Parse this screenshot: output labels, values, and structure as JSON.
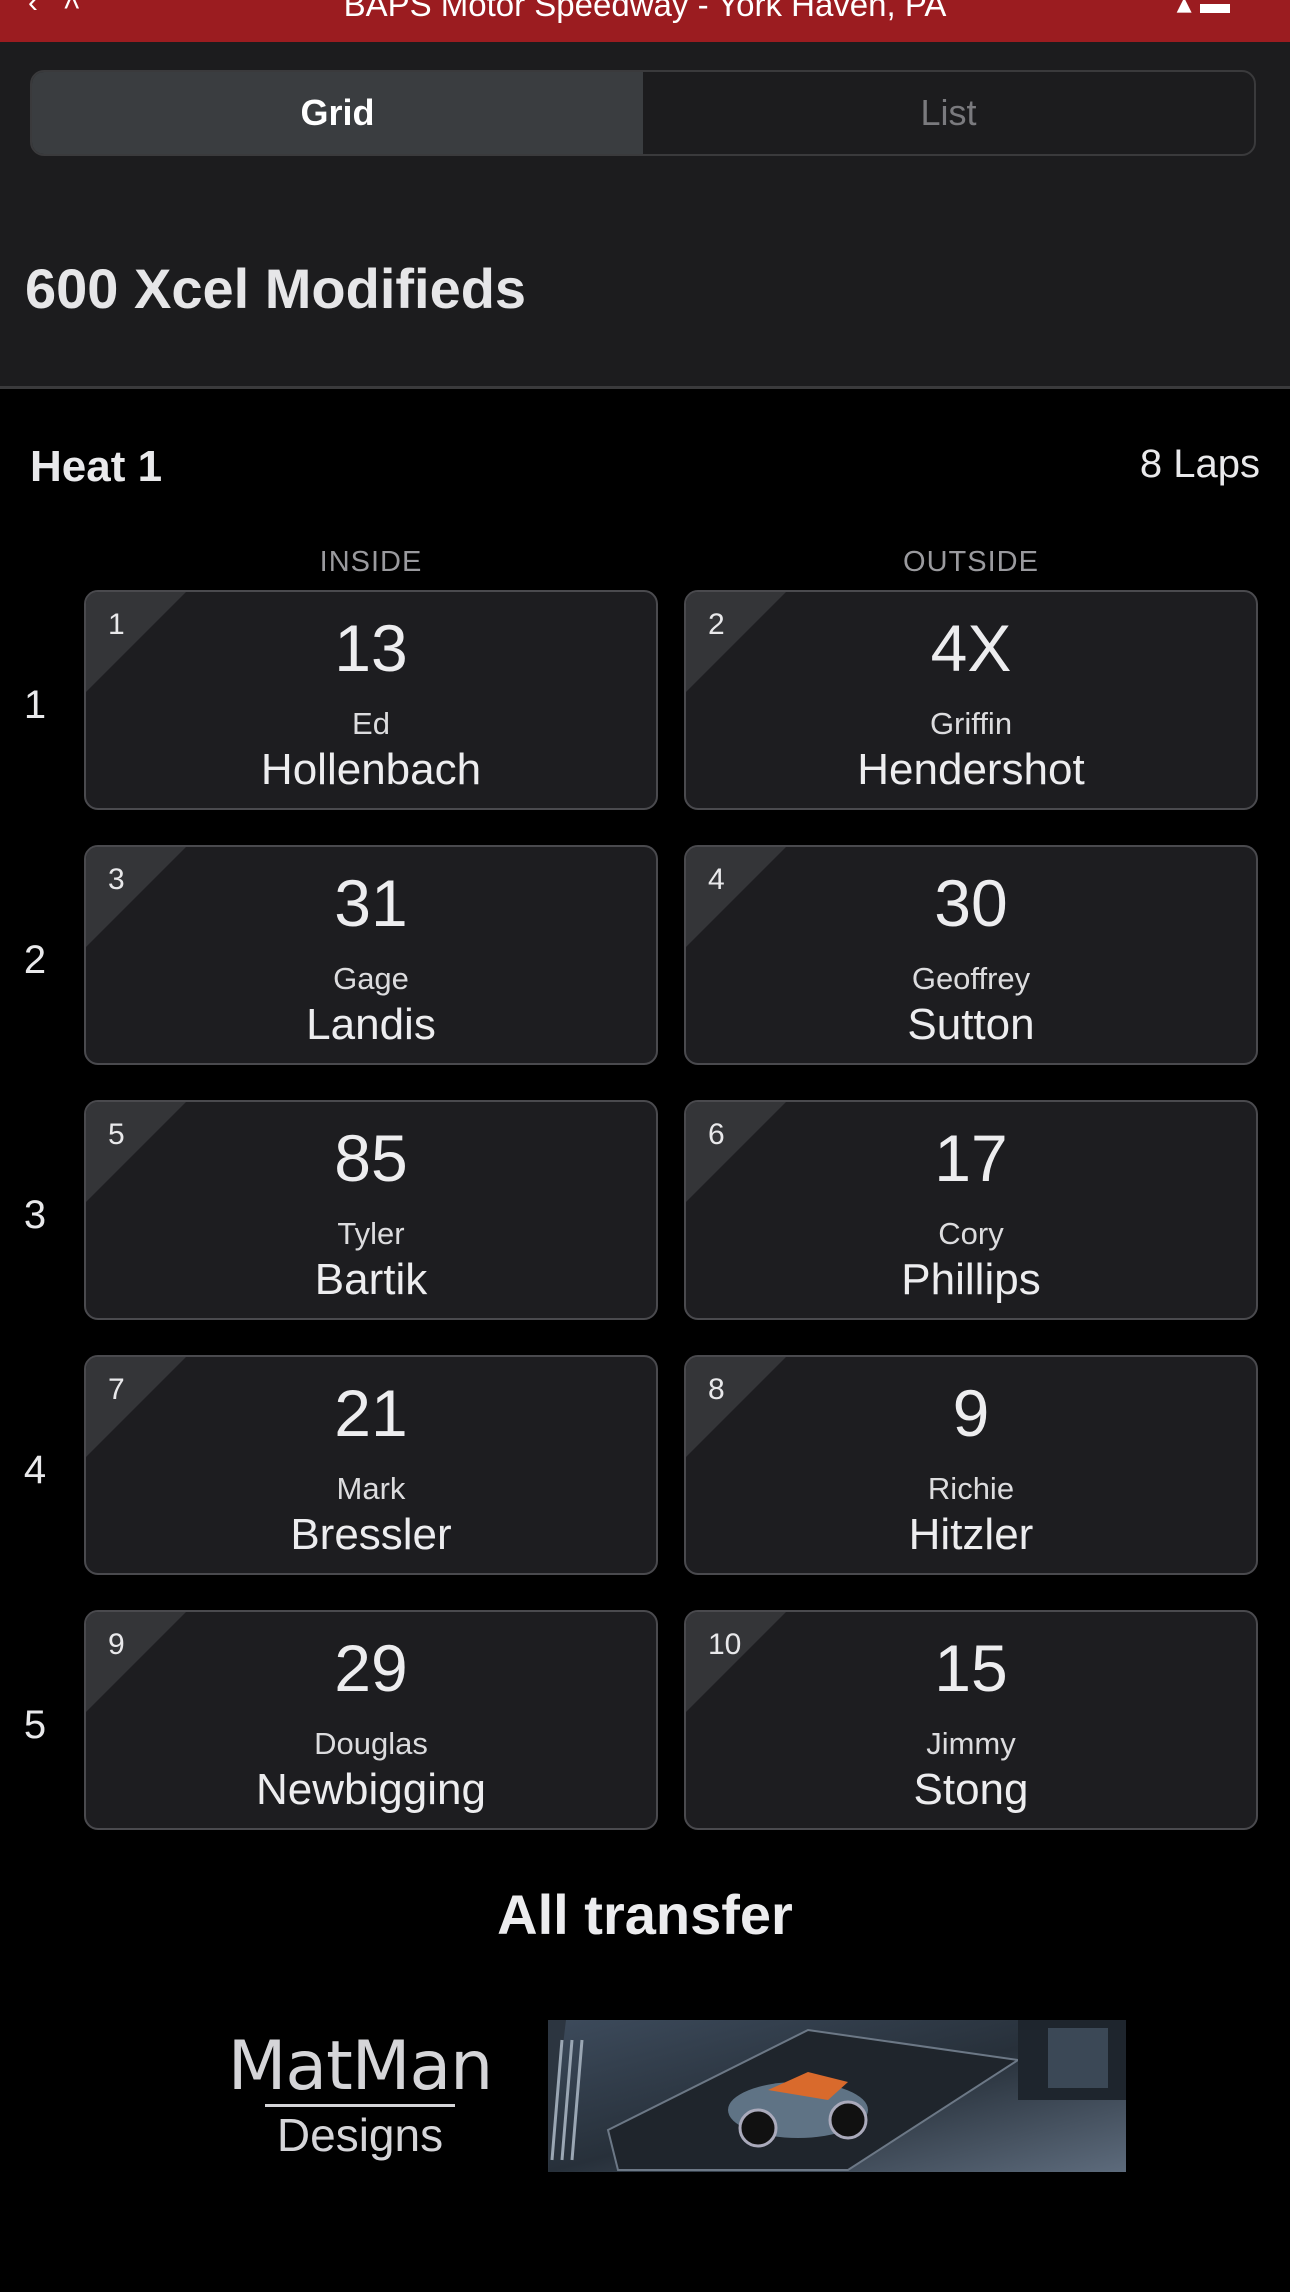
{
  "topbar": {
    "venue": "BAPS Motor Speedway - York Haven, PA",
    "bg_color": "#9b1c20"
  },
  "tabs": {
    "grid": "Grid",
    "list": "List",
    "selected": "Grid"
  },
  "class_title": "600 Xcel Modifieds",
  "heat": {
    "title": "Heat 1",
    "laps": "8 Laps",
    "inside_label": "INSIDE",
    "outside_label": "OUTSIDE",
    "rows": [
      {
        "row": "1",
        "inside": {
          "pos": "1",
          "car": "13",
          "first": "Ed",
          "last": "Hollenbach"
        },
        "outside": {
          "pos": "2",
          "car": "4X",
          "first": "Griffin",
          "last": "Hendershot"
        }
      },
      {
        "row": "2",
        "inside": {
          "pos": "3",
          "car": "31",
          "first": "Gage",
          "last": "Landis"
        },
        "outside": {
          "pos": "4",
          "car": "30",
          "first": "Geoffrey",
          "last": "Sutton"
        }
      },
      {
        "row": "3",
        "inside": {
          "pos": "5",
          "car": "85",
          "first": "Tyler",
          "last": "Bartik"
        },
        "outside": {
          "pos": "6",
          "car": "17",
          "first": "Cory",
          "last": "Phillips"
        }
      },
      {
        "row": "4",
        "inside": {
          "pos": "7",
          "car": "21",
          "first": "Mark",
          "last": "Bressler"
        },
        "outside": {
          "pos": "8",
          "car": "9",
          "first": "Richie",
          "last": "Hitzler"
        }
      },
      {
        "row": "5",
        "inside": {
          "pos": "9",
          "car": "29",
          "first": "Douglas",
          "last": "Newbigging"
        },
        "outside": {
          "pos": "10",
          "car": "15",
          "first": "Jimmy",
          "last": "Stong"
        }
      }
    ]
  },
  "footer_note": "All transfer",
  "ad": {
    "brand_line1": "MatMan",
    "brand_line2": "Designs"
  }
}
